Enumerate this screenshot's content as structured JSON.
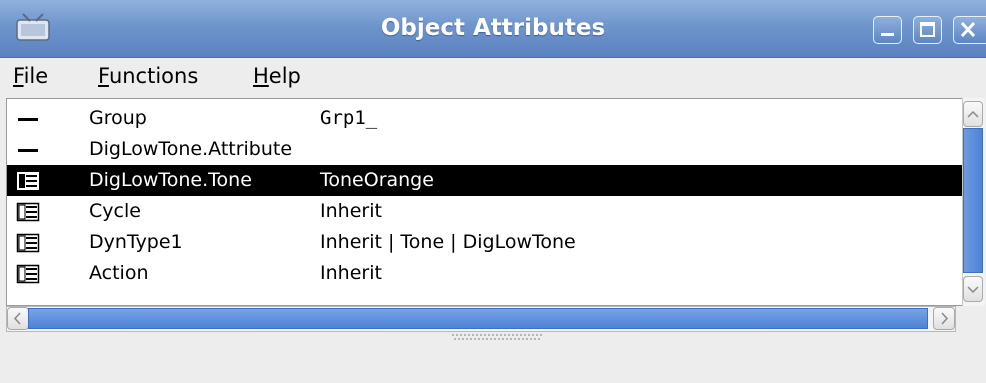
{
  "window": {
    "title": "Object Attributes"
  },
  "menubar": {
    "file": {
      "mnemonic": "F",
      "rest": "ile"
    },
    "functions": {
      "mnemonic": "F",
      "rest": "unctions"
    },
    "help": {
      "mnemonic": "H",
      "rest": "elp"
    }
  },
  "attributes": [
    {
      "icon": "dash-icon",
      "name": "Group",
      "value": "Grp1_",
      "selected": false
    },
    {
      "icon": "dash-icon",
      "name": "DigLowTone.Attribute",
      "value": "",
      "selected": false
    },
    {
      "icon": "folder-icon",
      "name": "DigLowTone.Tone",
      "value": "ToneOrange",
      "selected": true
    },
    {
      "icon": "folder-icon",
      "name": "Cycle",
      "value": "Inherit",
      "selected": false
    },
    {
      "icon": "folder-icon",
      "name": "DynType1",
      "value": "Inherit | Tone | DigLowTone",
      "selected": false
    },
    {
      "icon": "folder-icon",
      "name": "Action",
      "value": "Inherit",
      "selected": false
    }
  ],
  "colors": {
    "titlebar": "#6f95cc",
    "selection_bg": "#000000",
    "scroll_thumb": "#4e82d8"
  }
}
